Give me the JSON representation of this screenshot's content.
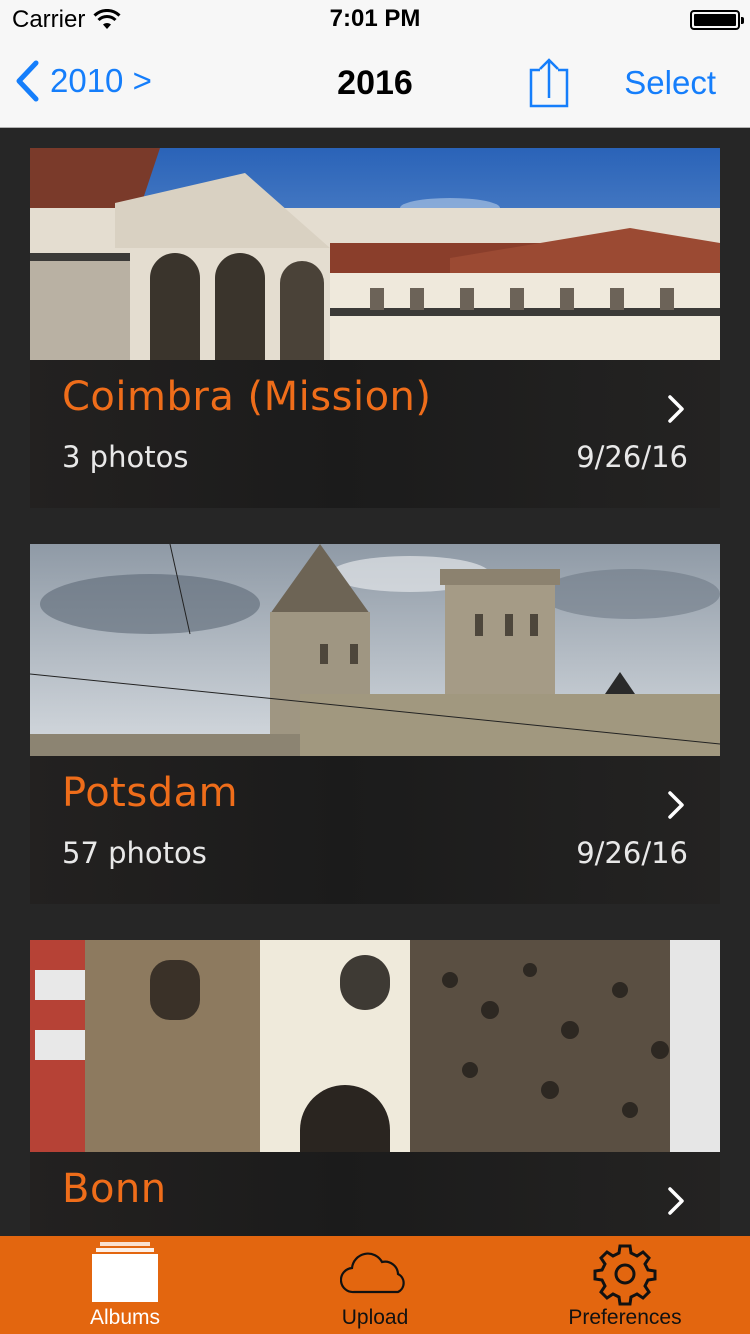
{
  "status_bar": {
    "carrier": "Carrier",
    "time": "7:01 PM"
  },
  "nav": {
    "back_label": "2010 >",
    "title": "2016",
    "select_label": "Select"
  },
  "albums": [
    {
      "title": "Coimbra (Mission)",
      "count": "3 photos",
      "date": "9/26/16"
    },
    {
      "title": "Potsdam",
      "count": "57 photos",
      "date": "9/26/16"
    },
    {
      "title": "Bonn",
      "count": "",
      "date": ""
    }
  ],
  "tabs": [
    {
      "label": "Albums",
      "active": true
    },
    {
      "label": "Upload",
      "active": false
    },
    {
      "label": "Preferences",
      "active": false
    }
  ],
  "colors": {
    "accent": "#e3660f",
    "title_orange": "#ef6d1a",
    "ios_blue": "#157efb"
  }
}
